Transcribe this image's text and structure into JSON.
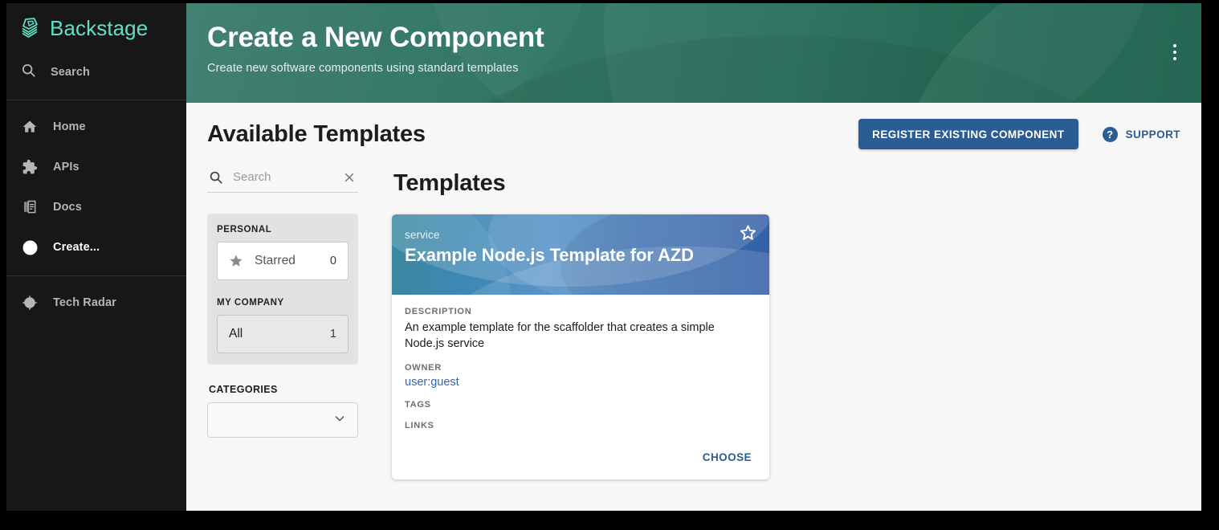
{
  "sidebar": {
    "logo_text": "Backstage",
    "search": {
      "label": "Search",
      "icon": "search-icon"
    },
    "items": [
      {
        "label": "Home",
        "icon": "home-icon",
        "active": false
      },
      {
        "label": "APIs",
        "icon": "puzzle-icon",
        "active": false
      },
      {
        "label": "Docs",
        "icon": "docs-icon",
        "active": false
      },
      {
        "label": "Create...",
        "icon": "plus-circle-icon",
        "active": true
      },
      {
        "label": "Tech Radar",
        "icon": "radar-icon",
        "active": false
      }
    ]
  },
  "header": {
    "title": "Create a New Component",
    "subtitle": "Create new software components using standard templates",
    "menu_icon": "kebab-menu-icon"
  },
  "toolbar": {
    "heading": "Available Templates",
    "register_label": "REGISTER EXISTING COMPONENT",
    "support_label": "SUPPORT",
    "support_icon": "help-icon"
  },
  "filters": {
    "search": {
      "value": "",
      "placeholder": "Search",
      "icon": "search-icon",
      "clear_icon": "close-icon"
    },
    "groups": [
      {
        "label": "PERSONAL",
        "rows": [
          {
            "label": "Starred",
            "count": "0",
            "icon": "star-icon",
            "selected": true
          }
        ]
      },
      {
        "label": "MY COMPANY",
        "rows": [
          {
            "label": "All",
            "count": "1",
            "icon": "",
            "selected": false
          }
        ]
      }
    ],
    "categories": {
      "label": "CATEGORIES",
      "value": "",
      "chevron_icon": "chevron-down-icon"
    }
  },
  "results": {
    "heading": "Templates",
    "cards": [
      {
        "kind": "service",
        "title": "Example Node.js Template for AZD",
        "star_icon": "star-outline-icon",
        "description_label": "DESCRIPTION",
        "description": "An example template for the scaffolder that creates a simple Node.js service",
        "owner_label": "OWNER",
        "owner": "user:guest",
        "tags_label": "TAGS",
        "tags": "",
        "links_label": "LINKS",
        "links": "",
        "choose_label": "CHOOSE"
      }
    ]
  },
  "colors": {
    "sidebar_bg": "#171717",
    "brand_teal": "#5ee2c6",
    "header_green": "#0c5943",
    "accent_blue": "#2b5c94",
    "card_blue": "#2f6fbb",
    "page_bg": "#f7f7f7"
  }
}
